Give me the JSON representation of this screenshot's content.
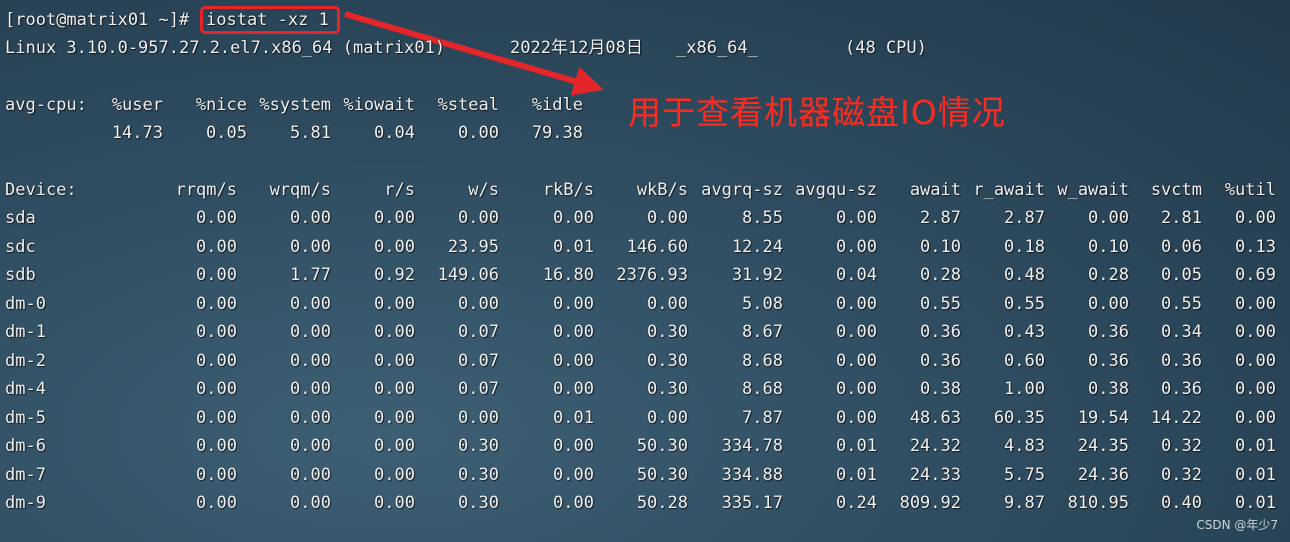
{
  "prompt": "[root@matrix01 ~]#",
  "command": "iostat -xz 1",
  "sysinfo": {
    "kernel": "Linux 3.10.0-957.27.2.el7.x86_64 (matrix01)",
    "date": "2022年12月08日",
    "arch": "_x86_64_",
    "cpus": "(48 CPU)"
  },
  "cpu": {
    "label": "avg-cpu:",
    "headers": [
      "%user",
      "%nice",
      "%system",
      "%iowait",
      "%steal",
      "%idle"
    ],
    "values": [
      "14.73",
      "0.05",
      "5.81",
      "0.04",
      "0.00",
      "79.38"
    ]
  },
  "device_table": {
    "headers": [
      "Device:",
      "rrqm/s",
      "wrqm/s",
      "r/s",
      "w/s",
      "rkB/s",
      "wkB/s",
      "avgrq-sz",
      "avgqu-sz",
      "await",
      "r_await",
      "w_await",
      "svctm",
      "%util"
    ],
    "rows": [
      [
        "sda",
        "0.00",
        "0.00",
        "0.00",
        "0.00",
        "0.00",
        "0.00",
        "8.55",
        "0.00",
        "2.87",
        "2.87",
        "0.00",
        "2.81",
        "0.00"
      ],
      [
        "sdc",
        "0.00",
        "0.00",
        "0.00",
        "23.95",
        "0.01",
        "146.60",
        "12.24",
        "0.00",
        "0.10",
        "0.18",
        "0.10",
        "0.06",
        "0.13"
      ],
      [
        "sdb",
        "0.00",
        "1.77",
        "0.92",
        "149.06",
        "16.80",
        "2376.93",
        "31.92",
        "0.04",
        "0.28",
        "0.48",
        "0.28",
        "0.05",
        "0.69"
      ],
      [
        "dm-0",
        "0.00",
        "0.00",
        "0.00",
        "0.00",
        "0.00",
        "0.00",
        "5.08",
        "0.00",
        "0.55",
        "0.55",
        "0.00",
        "0.55",
        "0.00"
      ],
      [
        "dm-1",
        "0.00",
        "0.00",
        "0.00",
        "0.07",
        "0.00",
        "0.30",
        "8.67",
        "0.00",
        "0.36",
        "0.43",
        "0.36",
        "0.34",
        "0.00"
      ],
      [
        "dm-2",
        "0.00",
        "0.00",
        "0.00",
        "0.07",
        "0.00",
        "0.30",
        "8.68",
        "0.00",
        "0.36",
        "0.60",
        "0.36",
        "0.36",
        "0.00"
      ],
      [
        "dm-4",
        "0.00",
        "0.00",
        "0.00",
        "0.07",
        "0.00",
        "0.30",
        "8.68",
        "0.00",
        "0.38",
        "1.00",
        "0.38",
        "0.36",
        "0.00"
      ],
      [
        "dm-5",
        "0.00",
        "0.00",
        "0.00",
        "0.00",
        "0.01",
        "0.00",
        "7.87",
        "0.00",
        "48.63",
        "60.35",
        "19.54",
        "14.22",
        "0.00"
      ],
      [
        "dm-6",
        "0.00",
        "0.00",
        "0.00",
        "0.30",
        "0.00",
        "50.30",
        "334.78",
        "0.01",
        "24.32",
        "4.83",
        "24.35",
        "0.32",
        "0.01"
      ],
      [
        "dm-7",
        "0.00",
        "0.00",
        "0.00",
        "0.30",
        "0.00",
        "50.30",
        "334.88",
        "0.01",
        "24.33",
        "5.75",
        "24.36",
        "0.32",
        "0.01"
      ],
      [
        "dm-9",
        "0.00",
        "0.00",
        "0.00",
        "0.30",
        "0.00",
        "50.28",
        "335.17",
        "0.24",
        "809.92",
        "9.87",
        "810.95",
        "0.40",
        "0.01"
      ]
    ]
  },
  "annotation": "用于查看机器磁盘IO情况",
  "watermark": "CSDN @年少7",
  "colors": {
    "highlight": "#e4262b",
    "annotation": "#ff2a1e"
  }
}
